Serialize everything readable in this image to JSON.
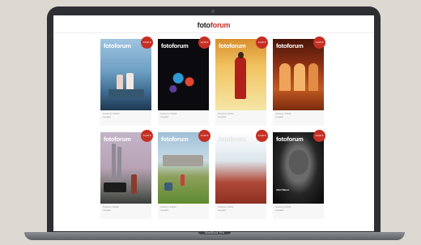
{
  "site": {
    "logo_prefix": "foto",
    "logo_suffix": "forum"
  },
  "laptop_model": "MacBook Pro",
  "colors": {
    "accent": "#c62f24",
    "bezel": "#2d2f33",
    "background": "#dcd8d2"
  },
  "cards": [
    {
      "brand": "fotoforum",
      "badge": "14,90 €",
      "meta1": "Fotoforum 6/2022",
      "meta2": "Ausgabe"
    },
    {
      "brand": "fotoforum",
      "badge": "14,90 €",
      "meta1": "Fotoforum 5/2022",
      "meta2": "Ausgabe"
    },
    {
      "brand": "fotoforum",
      "badge": "14,90 €",
      "meta1": "fotoforum 4/2022",
      "meta2": "Ausgabe"
    },
    {
      "brand": "fotoforum",
      "badge": "14,90 €",
      "meta1": "fotoforum 3/2022",
      "meta2": "Ausgabe"
    },
    {
      "brand": "fotoforum",
      "badge": "14,90 €",
      "meta1": "fotoforum 2/2022",
      "meta2": "Ausgabe"
    },
    {
      "brand": "fotoforum",
      "badge": "14,90 €",
      "meta1": "fotoforum 1/2022",
      "meta2": "Ausgabe"
    },
    {
      "brand": "fotoforum",
      "badge": "14,90 €",
      "meta1": "fotoforum 6/2021",
      "meta2": "Ausgabe"
    },
    {
      "brand": "fotoforum",
      "badge": "14,90 €",
      "meta1": "fotoforum 5/2021",
      "meta2": "Ausgabe",
      "cover_line": "Albert Watson"
    }
  ]
}
